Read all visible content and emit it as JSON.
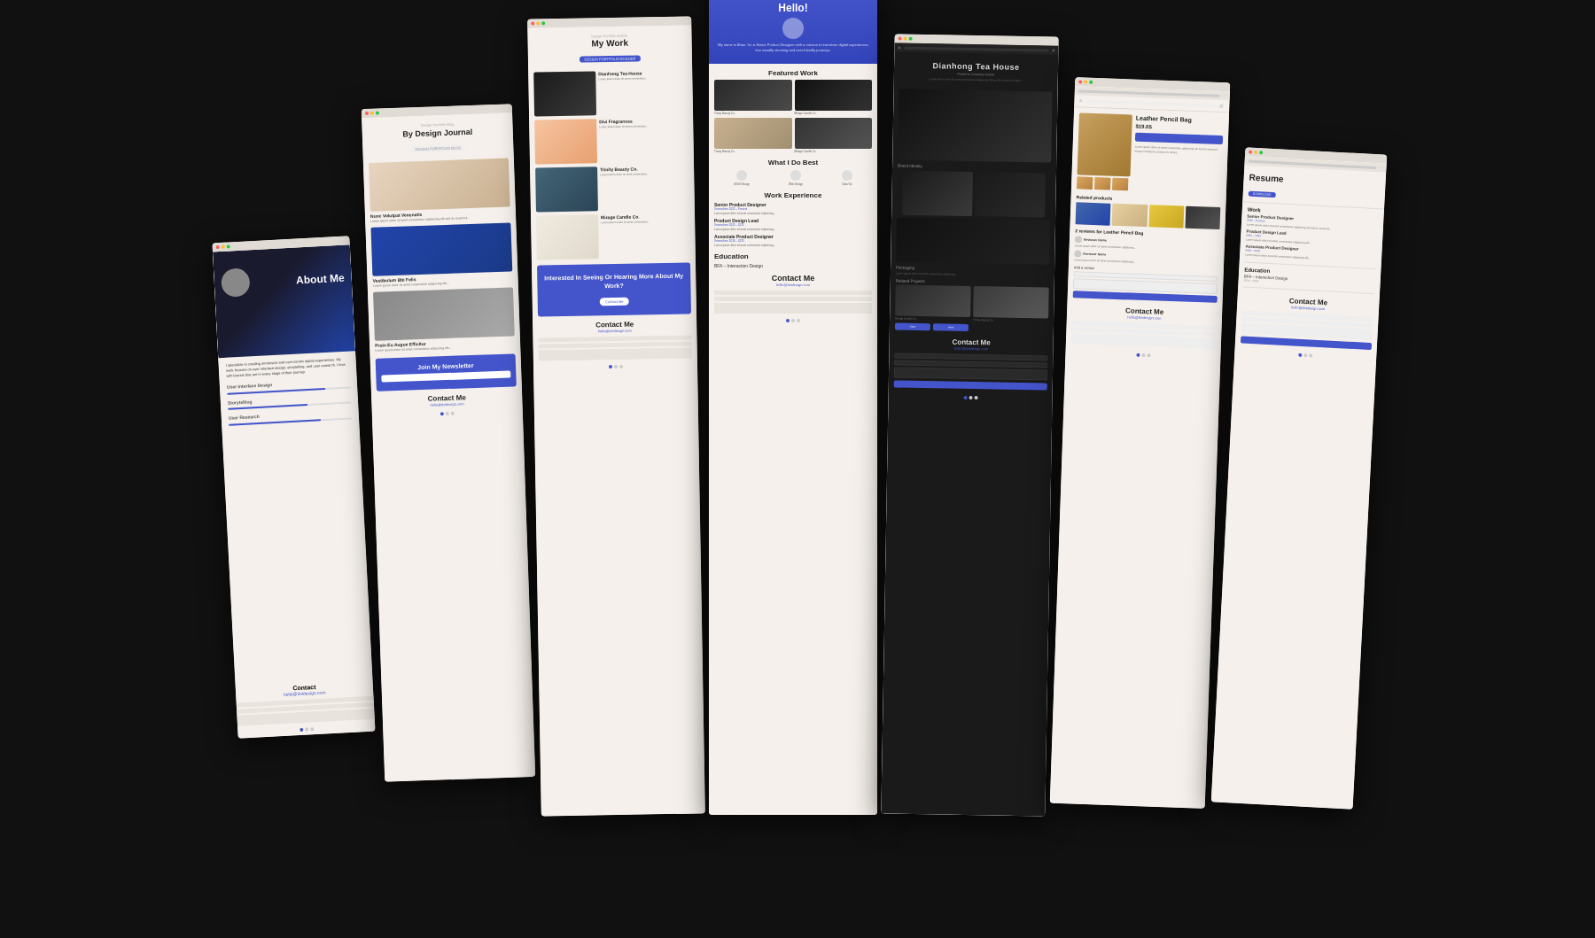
{
  "stage": {
    "background": "#111111"
  },
  "card1": {
    "title": "About Me",
    "contact_title": "Contact",
    "email": "hello@dvidesign.com",
    "skills": [
      "User Interface Design",
      "Storytelling",
      "User Research"
    ],
    "bio": "I specialize in creating immersive and user-centric digital experiences. My work focuses on user interface design, storytelling, and user research. I love with brands that are in every stage of their journey."
  },
  "card2": {
    "title": "By Design Journal",
    "badge": "DESIGN PORTFOLIO BLOG",
    "posts": [
      {
        "title": "Nunc Volutpat Venenatis"
      },
      {
        "title": "Vestibulum Bbi Felis"
      },
      {
        "title": "Proin Eu Augue Efficitur"
      }
    ],
    "newsletter_title": "Join My Newsletter",
    "contact_title": "Contact Me",
    "email": "hello@dvidesign.com"
  },
  "card3": {
    "title": "My Work",
    "badge": "DESIGN PORTFOLIO BUILDER",
    "projects": [
      {
        "title": "Dianhong Tea House"
      },
      {
        "title": "Divi Fragrances"
      },
      {
        "title": "Trinity Beauty Co."
      },
      {
        "title": "Mirage Candle Co."
      }
    ],
    "cta_title": "Interested In Seeing Or Hearing More About My Work?",
    "cta_btn": "Contact Me",
    "contact_title": "Contact Me",
    "email": "hello@dvidesign.com"
  },
  "card4": {
    "hello": "Hello!",
    "name": "Brian",
    "role": "Senior Product Designer",
    "description": "My name is Brian. I'm a Senior Product Designer with a mission to transform digital experiences into visually stunning and user-friendly journeys.",
    "featured_work_title": "Featured Work",
    "work_items": [
      {
        "label": "Trinity Beauty Co."
      },
      {
        "label": "Mirage Candle Co."
      },
      {
        "label": "Trinity Beauty Co."
      },
      {
        "label": "Mirage Candle Co."
      }
    ],
    "what_i_do_title": "What I Do Best",
    "skills": [
      "UX/UI Design",
      "Web Design",
      "Data Viz"
    ],
    "experience_title": "Work Experience",
    "experience": [
      {
        "title": "Senior Product Designer",
        "date": "Somewhere 2022 – Present"
      },
      {
        "title": "Product Design Lead",
        "date": "Somewhere 2020 – 2022"
      },
      {
        "title": "Associate Product Designer",
        "date": "Somewhere 2018 – 2020"
      }
    ],
    "education_title": "Education",
    "education": "BFA – Interaction Design",
    "contact_title": "Contact Me",
    "email": "hello@dvidesign.com"
  },
  "card5": {
    "title": "Dianhong Tea House",
    "subtitle": "Project & Company Details",
    "sections": {
      "brand_identity": "Brand Identity",
      "packaging": "Packaging",
      "related_projects": "Related Projects"
    },
    "related_items": [
      "Mirage Candle Co.",
      "Trinity Beauty Co."
    ],
    "contact_title": "Contact Me",
    "email": "hello@dvidesign.com"
  },
  "card6": {
    "title": "Leather Pencil Bag",
    "price": "$19.05",
    "related_label": "Related products",
    "reviews_label": "2 reviews for Leather Pencil Bag",
    "add_review_label": "Add a review",
    "contact_title": "Contact Me",
    "email": "hello@dvidesign.com"
  },
  "card7": {
    "title": "Resume",
    "badge": "DOWNLOAD",
    "work_title": "Work",
    "experience": [
      {
        "title": "Senior Product Designer",
        "date": "2022 – Present"
      },
      {
        "title": "Product Design Lead",
        "date": "2020 – 2022"
      },
      {
        "title": "Associate Product Designer",
        "date": "2018 – 2020"
      }
    ],
    "education_title": "Education",
    "education": "BFA – Interaction Design",
    "contact_title": "Contact Me",
    "email": "hello@dvidesign.com"
  }
}
